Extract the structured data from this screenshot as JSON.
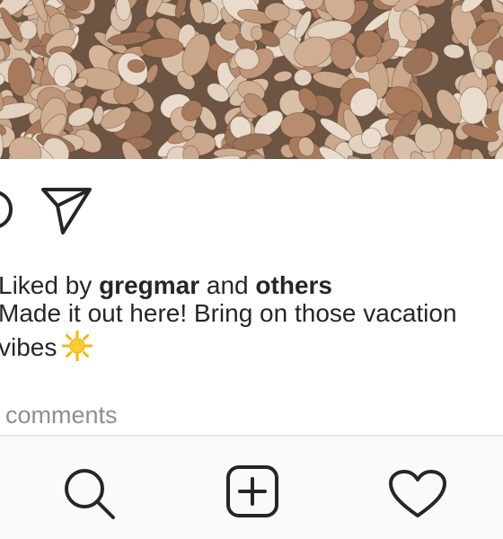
{
  "post": {
    "liked_by_prefix": "Liked by",
    "liked_by_user": "gregmar",
    "liked_by_joiner": "and",
    "liked_by_suffix": "others",
    "caption_line1": "Made it out here! Bring on those vacation",
    "caption_line2": "vibes",
    "caption_emoji": "sun-emoji",
    "comments_label": "comments"
  },
  "icons": {
    "comment": "comment-icon",
    "share": "paper-plane-icon",
    "nav_search": "search-icon",
    "nav_add": "add-post-icon",
    "nav_activity": "heart-icon"
  },
  "colors": {
    "text": "#262626",
    "muted": "#8e8e8e",
    "navbar_bg": "#fafafa",
    "sun": "#f5b800"
  }
}
